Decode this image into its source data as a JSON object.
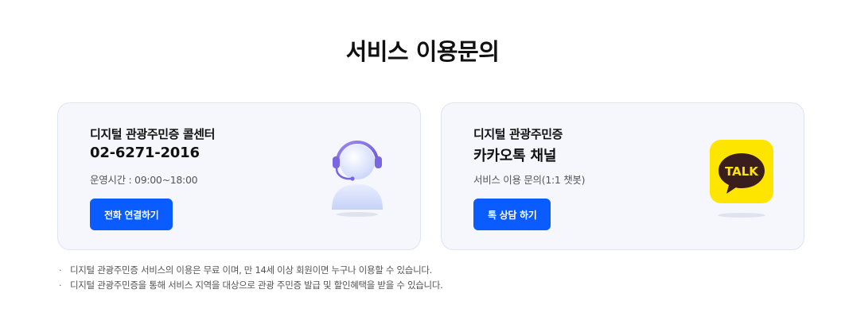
{
  "page": {
    "title": "서비스 이용문의"
  },
  "call_center": {
    "label": "디지털 관광주민증 콜센터",
    "phone": "02-6271-2016",
    "hours": "운영시간 : 09:00~18:00",
    "button_label": "전화 연결하기",
    "icon": "headset-agent-icon"
  },
  "kakao": {
    "label": "디지털 관광주민증",
    "channel": "카카오톡 채널",
    "desc": "서비스 이용 문의(1:1 챗봇)",
    "button_label": "톡 상담 하기",
    "icon": "kakao-talk-icon",
    "icon_text": "TALK"
  },
  "notes": [
    "디지털 관광주민증 서비스의 이용은 무료 이며, 만 14세 이상 회원이면 누구나 이용할 수 있습니다.",
    "디지털 관광주민증을 통해 서비스 지역을 대상으로 관광 주민증 발급 및 할인혜택을 받을 수 있습니다."
  ],
  "colors": {
    "accent": "#0a5cff",
    "card_bg": "#f5f7fc",
    "kakao_yellow": "#fee500",
    "kakao_brown": "#3a1d1d"
  }
}
